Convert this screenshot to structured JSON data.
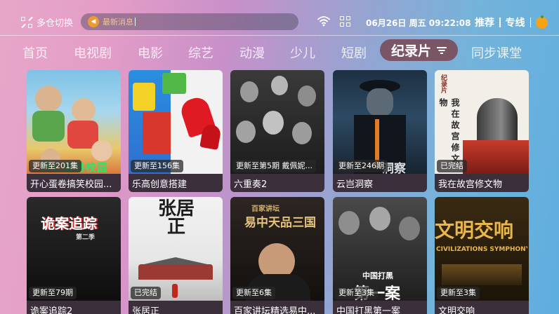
{
  "header": {
    "switch_label": "多仓切换",
    "search_placeholder": "最新消息",
    "datetime": "06月26日 周五 09:22:08",
    "links": [
      "推荐",
      "专线"
    ]
  },
  "tabs": [
    {
      "label": "首页"
    },
    {
      "label": "电视剧"
    },
    {
      "label": "电影"
    },
    {
      "label": "综艺"
    },
    {
      "label": "动漫"
    },
    {
      "label": "少儿"
    },
    {
      "label": "短剧"
    },
    {
      "label": "纪录片",
      "active": true
    },
    {
      "label": "同步课堂"
    }
  ],
  "cards": [
    {
      "title": "开心蛋卷搞笑校园...",
      "badge": "更新至201集",
      "poster_text": "开心蛋卷校园"
    },
    {
      "title": "乐高创意搭建",
      "badge": "更新至156集",
      "poster_text": ""
    },
    {
      "title": "六重奏2",
      "badge": "更新至第5期 戴佩妮...",
      "poster_text": ""
    },
    {
      "title": "云岂洞察",
      "badge": "更新至246期",
      "poster_text": "洞察"
    },
    {
      "title": "我在故宫修文物",
      "badge": "已完结",
      "poster_text": "我在故宫修文物",
      "poster_sub": "纪录片"
    },
    {
      "title": "诡案追踪2",
      "badge": "更新至79期",
      "poster_text": "诡案追踪",
      "poster_sub": "第二季"
    },
    {
      "title": "张居正",
      "badge": "已完结",
      "poster_text": "张居正"
    },
    {
      "title": "百家讲坛精选易中...",
      "badge": "更新至6集",
      "poster_text": "易中天品三国",
      "poster_sub": "百家讲坛"
    },
    {
      "title": "中国打黑第一案",
      "badge": "更新至3集",
      "poster_text": "第一案",
      "poster_sub": "中国打黑"
    },
    {
      "title": "文明交响",
      "badge": "更新至3集",
      "poster_text": "文明交响",
      "poster_sub": "CIVILIZATIONS SYMPHONY"
    }
  ]
}
